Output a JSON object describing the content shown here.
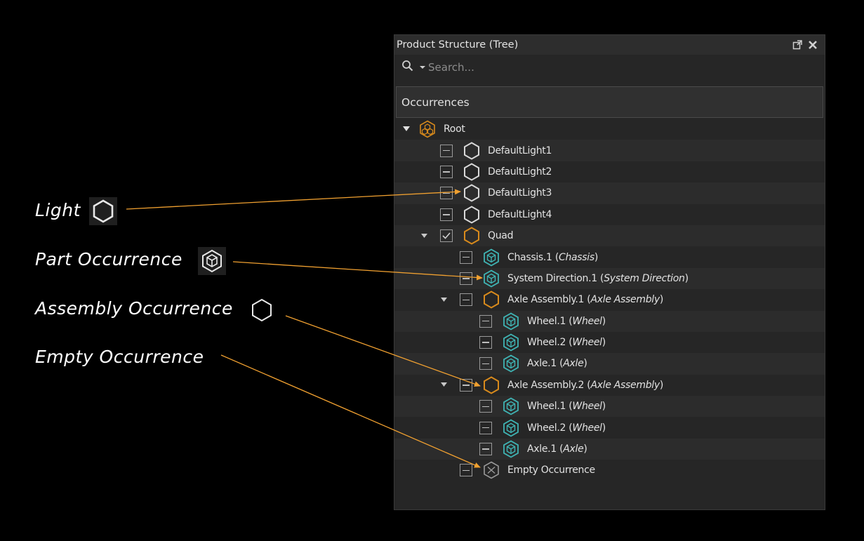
{
  "legend": {
    "light": "Light",
    "part_occurrence": "Part Occurrence",
    "assembly_occurrence": "Assembly Occurrence",
    "empty_occurrence": "Empty Occurrence"
  },
  "panel": {
    "title": "Product Structure (Tree)",
    "search_placeholder": "Search...",
    "column_header": "Occurrences"
  },
  "tree": {
    "root": "Root",
    "light1": "DefaultLight1",
    "light2": "DefaultLight2",
    "light3": "DefaultLight3",
    "light4": "DefaultLight4",
    "quad": "Quad",
    "chassis": "Chassis.1",
    "chassis_ref": "Chassis",
    "system_direction": "System Direction.1",
    "system_direction_ref": "System Direction",
    "axle_assembly_1": "Axle Assembly.1",
    "axle_assembly_1_ref": "Axle Assembly",
    "a1_wheel1": "Wheel.1",
    "a1_wheel1_ref": "Wheel",
    "a1_wheel2": "Wheel.2",
    "a1_wheel2_ref": "Wheel",
    "a1_axle": "Axle.1",
    "a1_axle_ref": "Axle",
    "axle_assembly_2": "Axle Assembly.2",
    "axle_assembly_2_ref": "Axle Assembly",
    "a2_wheel1": "Wheel.1",
    "a2_wheel1_ref": "Wheel",
    "a2_wheel2": "Wheel.2",
    "a2_wheel2_ref": "Wheel",
    "a2_axle": "Axle.1",
    "a2_axle_ref": "Axle",
    "empty": "Empty Occurrence"
  },
  "icons": {
    "light": "light-hexagon-icon",
    "part": "part-cube-icon",
    "assembly": "assembly-hexagon-icon",
    "empty": "empty-hexagon-icon",
    "root": "root-assembly-icon"
  },
  "colors": {
    "assembly": "#d88a1c",
    "part": "#3fb4b4",
    "light": "#d8d8d8",
    "annotation_arrow": "#f0a030"
  }
}
